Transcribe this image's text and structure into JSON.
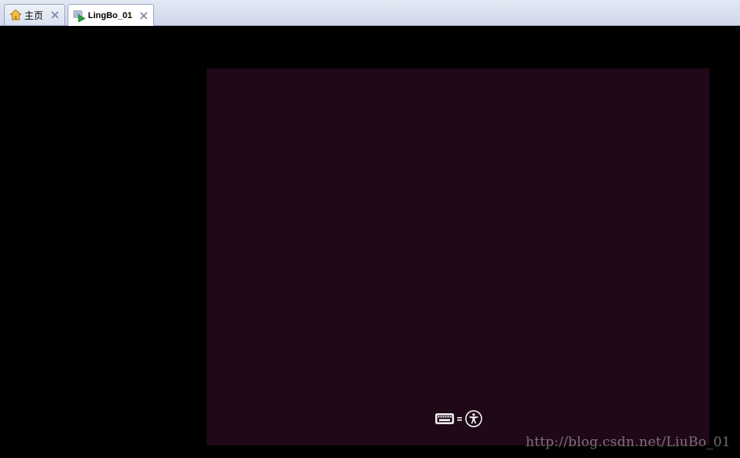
{
  "tabs": [
    {
      "label": "主页",
      "icon": "home-icon",
      "active": false
    },
    {
      "label": "LingBo_01",
      "icon": "vm-play-icon",
      "active": true
    }
  ],
  "vm_screen": {
    "background": "#1f0818",
    "status_icons": [
      "keyboard-icon",
      "accessibility-icon"
    ]
  },
  "watermark": "http://blog.csdn.net/LiuBo_01"
}
